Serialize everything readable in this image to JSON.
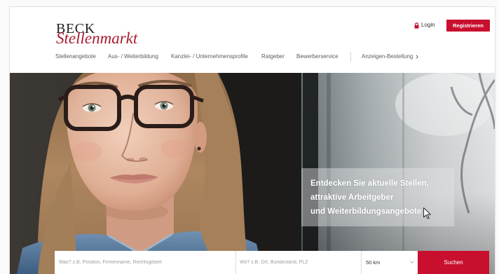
{
  "brand": {
    "name_top": "BECK",
    "name_bottom": "Stellenmarkt"
  },
  "account": {
    "login_label": "Login",
    "login_icon": "lock-icon",
    "register_label": "Registrieren"
  },
  "nav": {
    "items": [
      {
        "label": "Stellenangebote"
      },
      {
        "label": "Aus- / Weiterbildung"
      },
      {
        "label": "Kanzlei- / Unternehmensprofile"
      },
      {
        "label": "Ratgeber"
      },
      {
        "label": "Bewerberservice"
      }
    ],
    "order": {
      "label": "Anzeigen-Bestellung",
      "icon": "chevron-right-icon"
    }
  },
  "hero": {
    "tagline": [
      "Entdecken Sie aktuelle Stellen,",
      "attraktive Arbeitgeber",
      "und Weiterbildungsangebote"
    ],
    "cursor_icon": "mouse-pointer-icon"
  },
  "search": {
    "what_placeholder": "Was? z.B. Position, Firmenname, Rechtsgebiet",
    "where_placeholder": "Wo? z.B. Ort, Bundesland, PLZ",
    "radius_value": "50 km",
    "radius_icon": "chevron-down-icon",
    "submit_label": "Suchen"
  },
  "colors": {
    "brand_red": "#c8102e",
    "logo_red": "#a81c2f",
    "logo_dark": "#1f1f1f",
    "nav_text": "#5c5c5c"
  }
}
